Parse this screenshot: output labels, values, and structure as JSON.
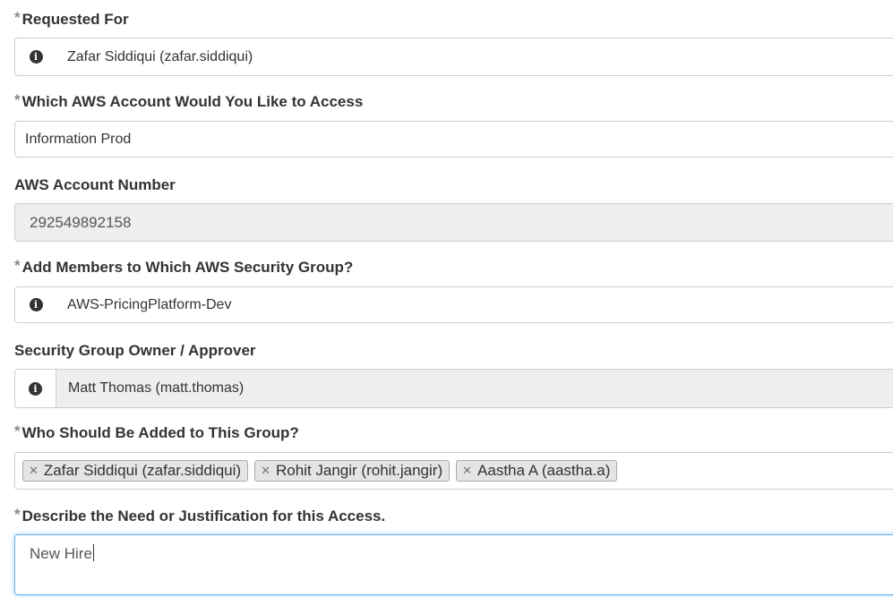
{
  "form": {
    "required_marker": "*",
    "requested_for": {
      "label": "Requested For",
      "value": "Zafar Siddiqui (zafar.siddiqui)",
      "icon": "info-icon"
    },
    "aws_account": {
      "label": "Which AWS Account Would You Like to Access",
      "value": "Information Prod"
    },
    "account_number": {
      "label": "AWS Account Number",
      "value": "292549892158"
    },
    "security_group": {
      "label": "Add Members to Which AWS Security Group?",
      "value": "AWS-PricingPlatform-Dev",
      "icon": "info-icon"
    },
    "group_owner": {
      "label": "Security Group Owner / Approver",
      "value": "Matt Thomas (matt.thomas)",
      "icon": "info-icon"
    },
    "members": {
      "label": "Who Should Be Added to This Group?",
      "remove_glyph": "✕",
      "tags": [
        "Zafar Siddiqui (zafar.siddiqui)",
        "Rohit Jangir (rohit.jangir)",
        "Aastha A (aastha.a)"
      ]
    },
    "justification": {
      "label": "Describe the Need or Justification for this Access.",
      "value": "New Hire"
    }
  },
  "colors": {
    "text": "#333333",
    "border": "#cccccc",
    "readonly_bg": "#eeeeee",
    "focus_border": "#66afe9",
    "tag_bg": "#e4e4e4"
  }
}
